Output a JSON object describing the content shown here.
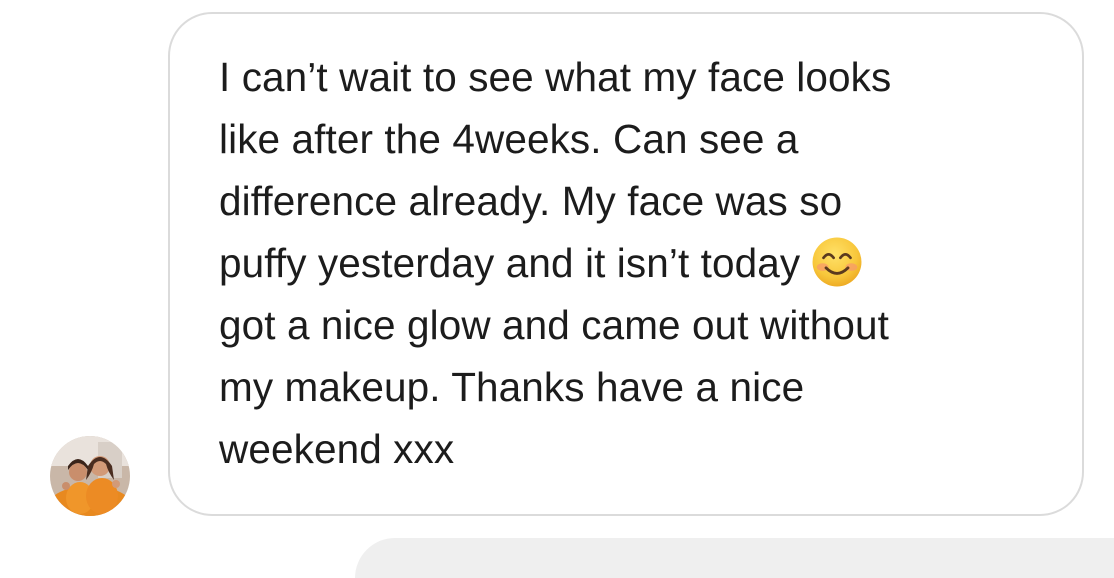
{
  "message": {
    "lines": [
      "I can’t wait to see what my face looks",
      "like after the 4weeks. Can see a",
      "difference already. My face was so",
      "puffy yesterday and it isn’t today",
      "got a nice glow and came out without",
      "my makeup. Thanks have a nice",
      "weekend xxx"
    ],
    "emoji": "smiling-face-with-smiling-eyes-icon"
  },
  "sender": {
    "avatar_icon": "avatar"
  },
  "colors": {
    "bubble_border": "#dbdbdb",
    "text": "#1c1c1c",
    "emoji_face": "#f7c33a",
    "emoji_blush": "#f5a05e"
  }
}
